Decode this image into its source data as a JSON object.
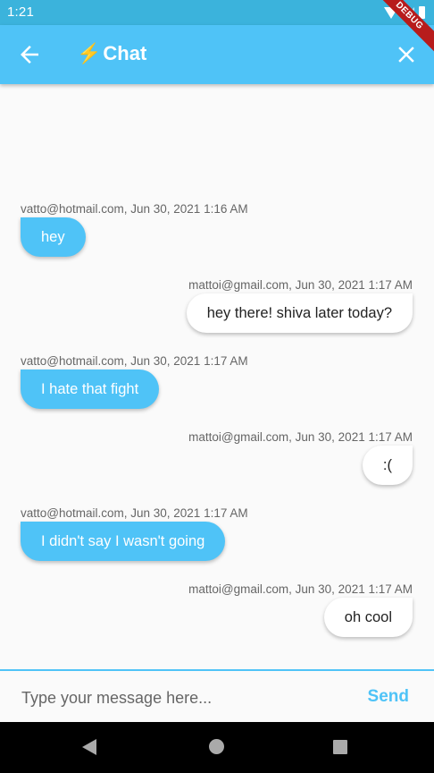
{
  "status_bar": {
    "time": "1:21",
    "debug_label": "DEBUG"
  },
  "app_bar": {
    "title": "Chat",
    "title_emoji": "⚡"
  },
  "messages": [
    {
      "side": "left",
      "meta": "vatto@hotmail.com, Jun 30, 2021 1:16 AM",
      "text": "hey"
    },
    {
      "side": "right",
      "meta": "mattoi@gmail.com, Jun 30, 2021 1:17 AM",
      "text": "hey there! shiva later today?"
    },
    {
      "side": "left",
      "meta": "vatto@hotmail.com, Jun 30, 2021 1:17 AM",
      "text": "I hate that fight"
    },
    {
      "side": "right",
      "meta": "mattoi@gmail.com, Jun 30, 2021 1:17 AM",
      "text": ":("
    },
    {
      "side": "left",
      "meta": "vatto@hotmail.com, Jun 30, 2021 1:17 AM",
      "text": "I didn't say I wasn't going"
    },
    {
      "side": "right",
      "meta": "mattoi@gmail.com, Jun 30, 2021 1:17 AM",
      "text": "oh cool"
    }
  ],
  "input": {
    "placeholder": "Type your message here...",
    "value": ""
  },
  "send_label": "Send",
  "colors": {
    "accent": "#4fc3f7",
    "status_bar": "#3bb3dc",
    "debug_ribbon": "#b71c1c"
  }
}
